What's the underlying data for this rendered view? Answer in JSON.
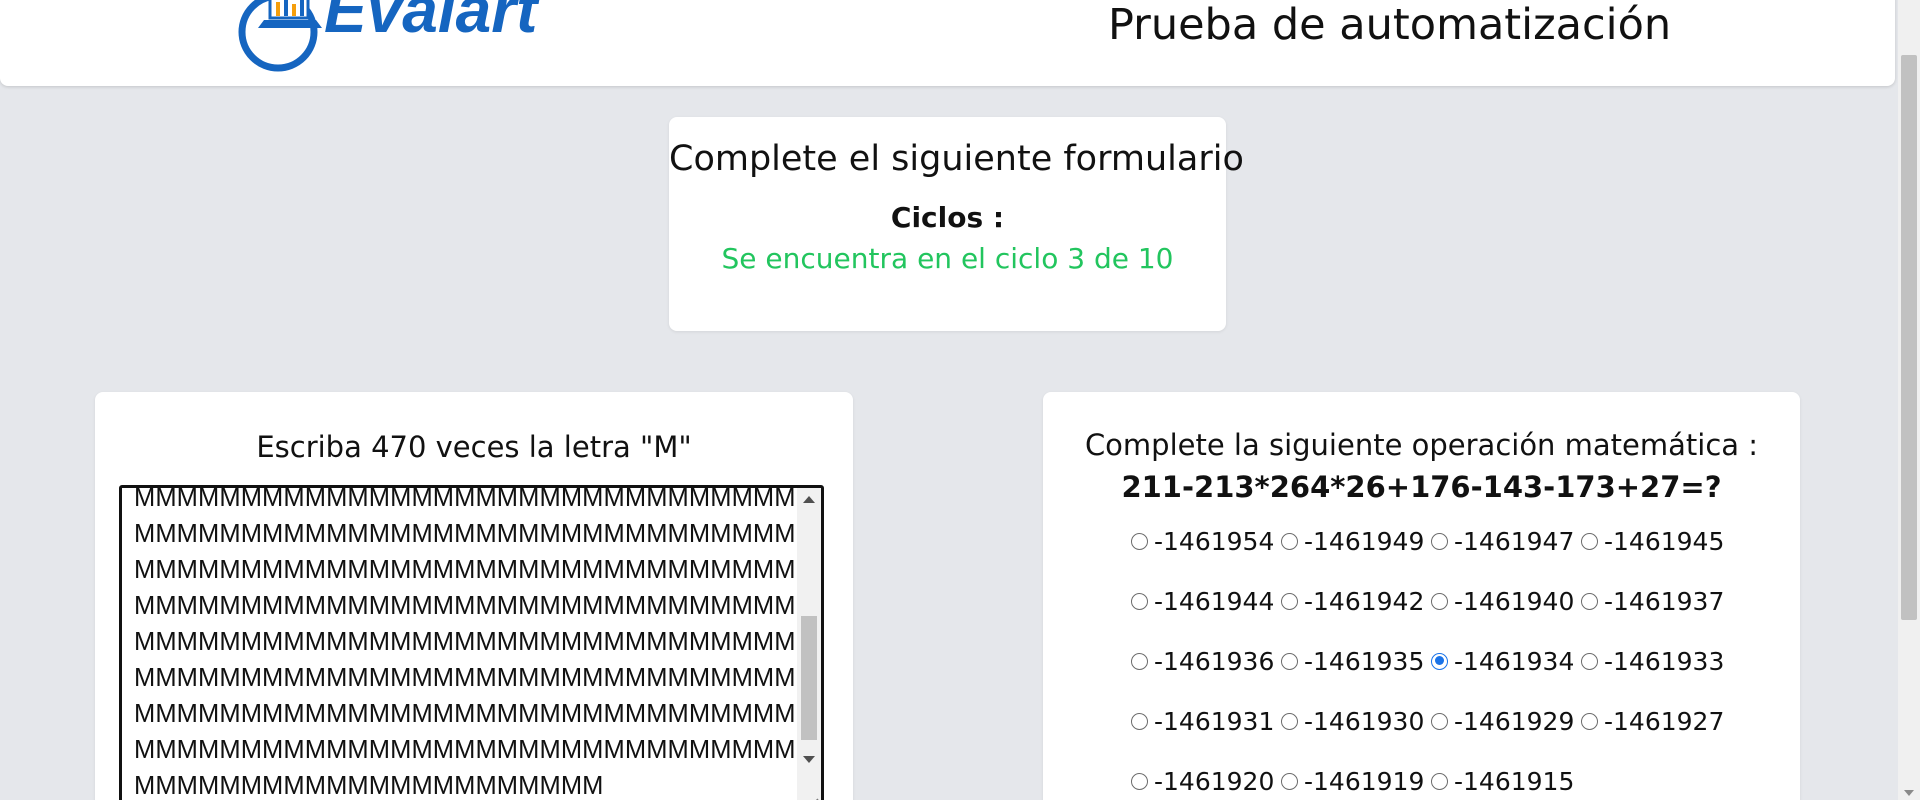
{
  "header": {
    "logo_text": "Evalart",
    "title": "Prueba de automatización"
  },
  "cycles": {
    "heading": "Complete el siguiente formulario",
    "label": "Ciclos :",
    "status": "Se encuentra en el ciclo 3 de 10",
    "status_color": "#22c55e"
  },
  "letters": {
    "prompt": "Escriba 470 veces la letra \"M\"",
    "lines": [
      "MMMMMMMMMMMMMMMMMMMMMMMMMMMMMMMM",
      "MMMMMMMMMMMMMMMMMMMMMMMMMMMMMMMM",
      "MMMMMMMMMMMMMMMMMMMMMMMMMMMMMMMM",
      "MMMMMMMMMMMMMMMMMMMMMMMMMMMMMMMM",
      "MMMMMMMMMMMMMMMMMMMMMMMMMMMMMMMM",
      "MMMMMMMMMMMMMMMMMMMMMMMMMMMMMMMM",
      "MMMMMMMMMMMMMMMMMMMMMMMMMMMMMMMM",
      "MMMMMMMMMMMMMMMMMMMMMMMMMMMMMMMM",
      "MMMMMMMMMMMMMMMMMMMMMM"
    ]
  },
  "math": {
    "prompt": "Complete la siguiente operación matemática :",
    "expression": "211-213*264*26+176-143-173+27=?",
    "selected": "-1461934",
    "options": [
      "-1461954",
      "-1461949",
      "-1461947",
      "-1461945",
      "-1461944",
      "-1461942",
      "-1461940",
      "-1461937",
      "-1461936",
      "-1461935",
      "-1461934",
      "-1461933",
      "-1461931",
      "-1461930",
      "-1461929",
      "-1461927",
      "-1461920",
      "-1461919",
      "-1461915"
    ]
  },
  "colors": {
    "brand": "#1565c0",
    "accent_radio": "#1a73e8",
    "background": "#e5e7eb"
  }
}
